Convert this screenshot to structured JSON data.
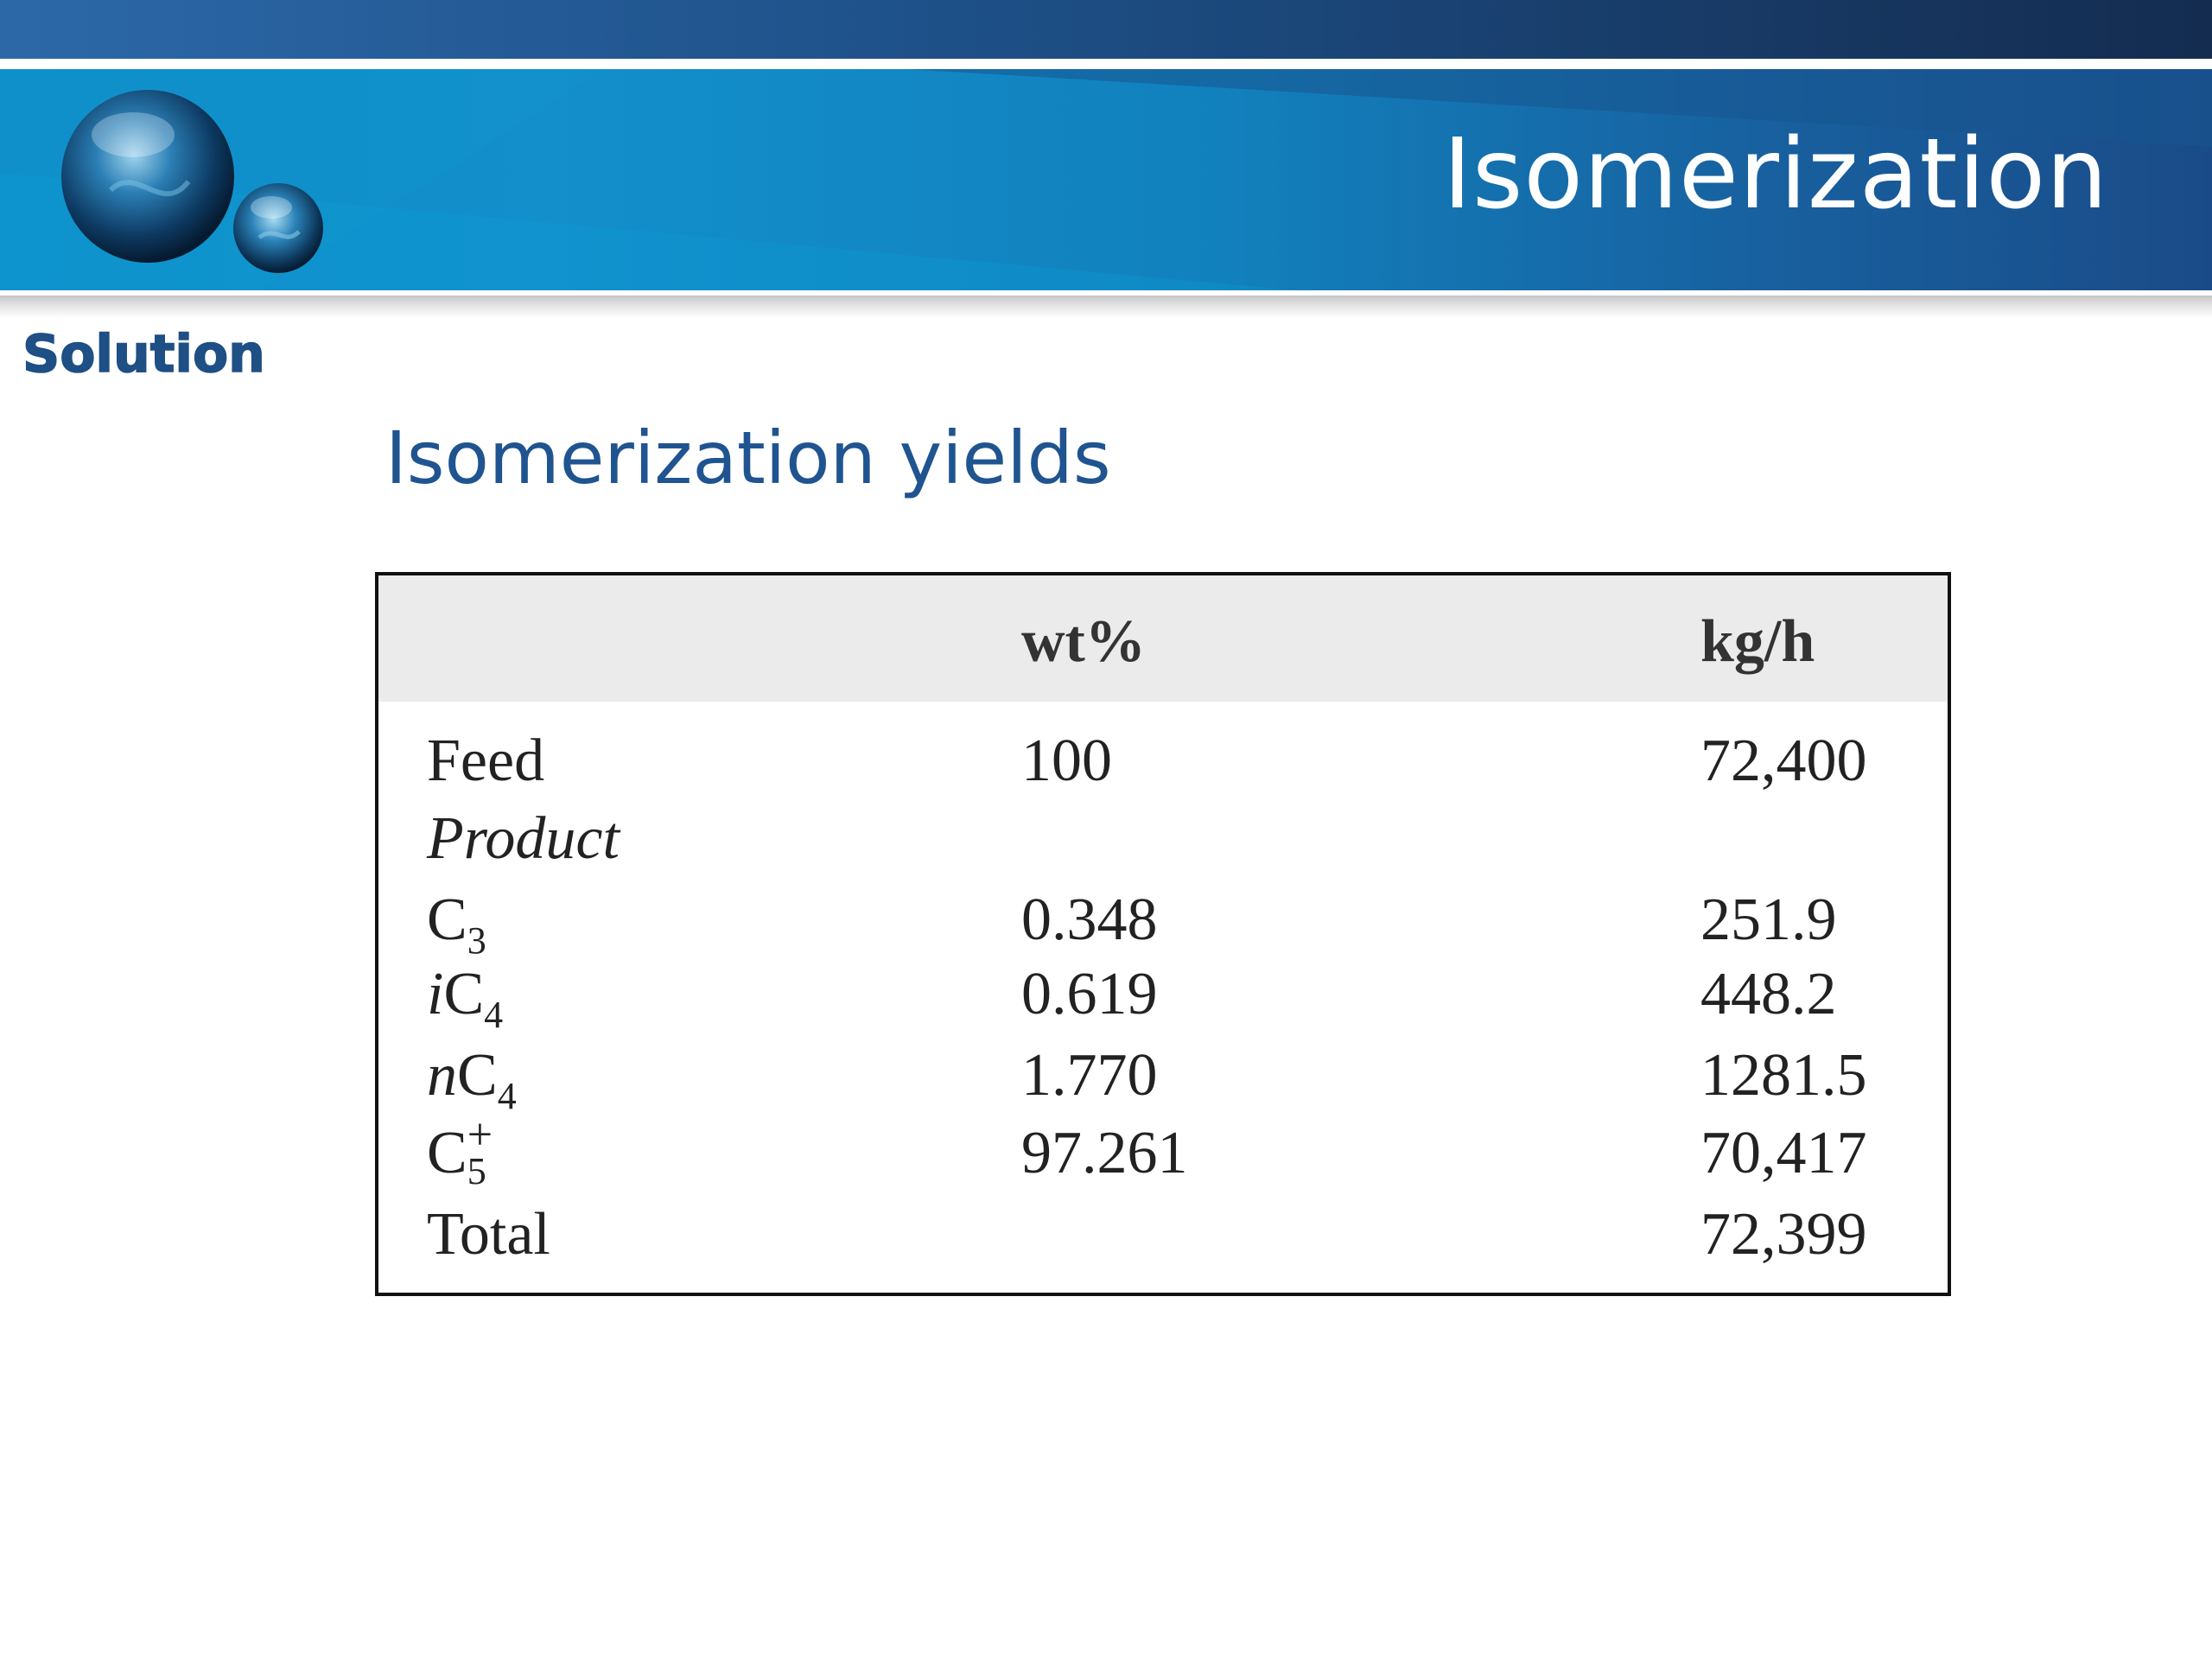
{
  "header": {
    "title": "Isomerization"
  },
  "section_label": "Solution",
  "subtitle": "Isomerization yields",
  "table": {
    "headers": [
      "",
      "wt%",
      "kg/h"
    ],
    "rows": [
      {
        "label": "Feed",
        "wt": "100",
        "kg": "72,400"
      },
      {
        "label": "Product",
        "wt": "",
        "kg": ""
      },
      {
        "label_base": "C",
        "label_sub": "3",
        "wt": "0.348",
        "kg": "251.9"
      },
      {
        "label_prefix": "i",
        "label_base": "C",
        "label_sub": "4",
        "wt": "0.619",
        "kg": "448.2"
      },
      {
        "label_prefix": "n",
        "label_base": "C",
        "label_sub": "4",
        "wt": "1.770",
        "kg": "1281.5"
      },
      {
        "label_base": "C",
        "label_sup": "+",
        "label_sub": "5",
        "wt": "97.261",
        "kg": "70,417"
      },
      {
        "label": "Total",
        "wt": "",
        "kg": "72,399"
      }
    ]
  },
  "colors": {
    "banner_start": "#0f8ec9",
    "banner_end": "#1a4b88",
    "heading_text": "#1e4f85"
  },
  "icons": [
    "sphere-logo-icon"
  ]
}
